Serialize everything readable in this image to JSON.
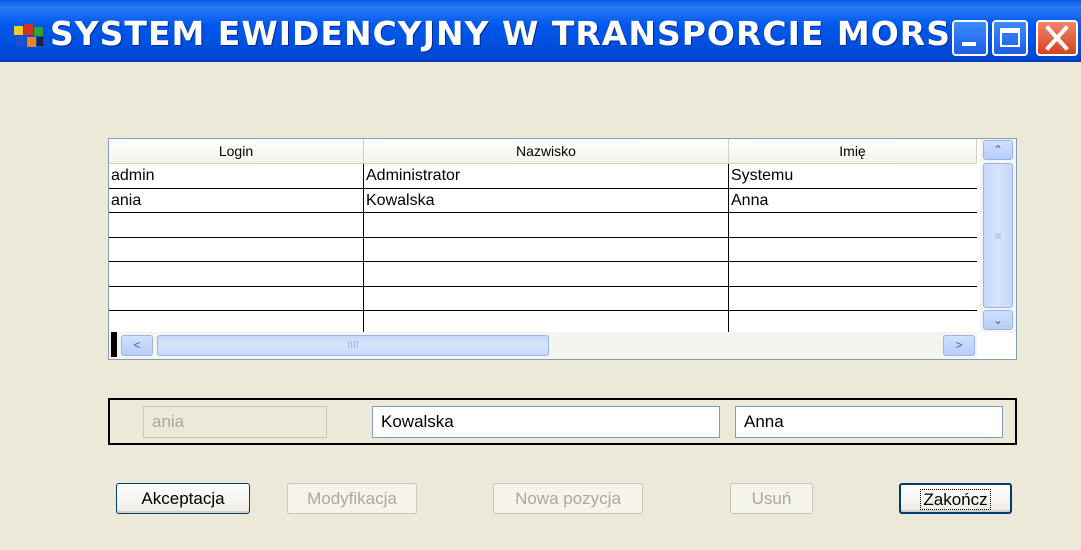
{
  "window": {
    "title": "SYSTEM EWIDENCYJNY W TRANSPORCIE MORSKIM",
    "app_icon": "app-icon",
    "controls": [
      "minimize-icon",
      "maximize-icon",
      "close-icon"
    ]
  },
  "table": {
    "columns": [
      "Login",
      "Nazwisko",
      "Imię"
    ],
    "rows": [
      [
        "admin",
        "Administrator",
        "Systemu"
      ],
      [
        "ania",
        "Kowalska",
        "Anna"
      ],
      [
        "",
        "",
        ""
      ],
      [
        "",
        "",
        ""
      ],
      [
        "",
        "",
        ""
      ],
      [
        "",
        "",
        ""
      ],
      [
        "",
        "",
        ""
      ]
    ],
    "scroll_glyphs": {
      "up": "⌃",
      "down": "⌄",
      "left": "<",
      "right": ">",
      "grip_v": "≡",
      "grip_h": "IIII"
    }
  },
  "edit": {
    "login": "ania",
    "nazwisko": "Kowalska",
    "imie": "Anna"
  },
  "buttons": {
    "accept": "Akceptacja",
    "modify": "Modyfikacja",
    "new": "Nowa pozycja",
    "delete": "Usuń",
    "close": "Zakończ"
  },
  "colors": {
    "titlebar": "#0058ee",
    "window_bg": "#ece9d8",
    "close_button": "#d6431e"
  }
}
